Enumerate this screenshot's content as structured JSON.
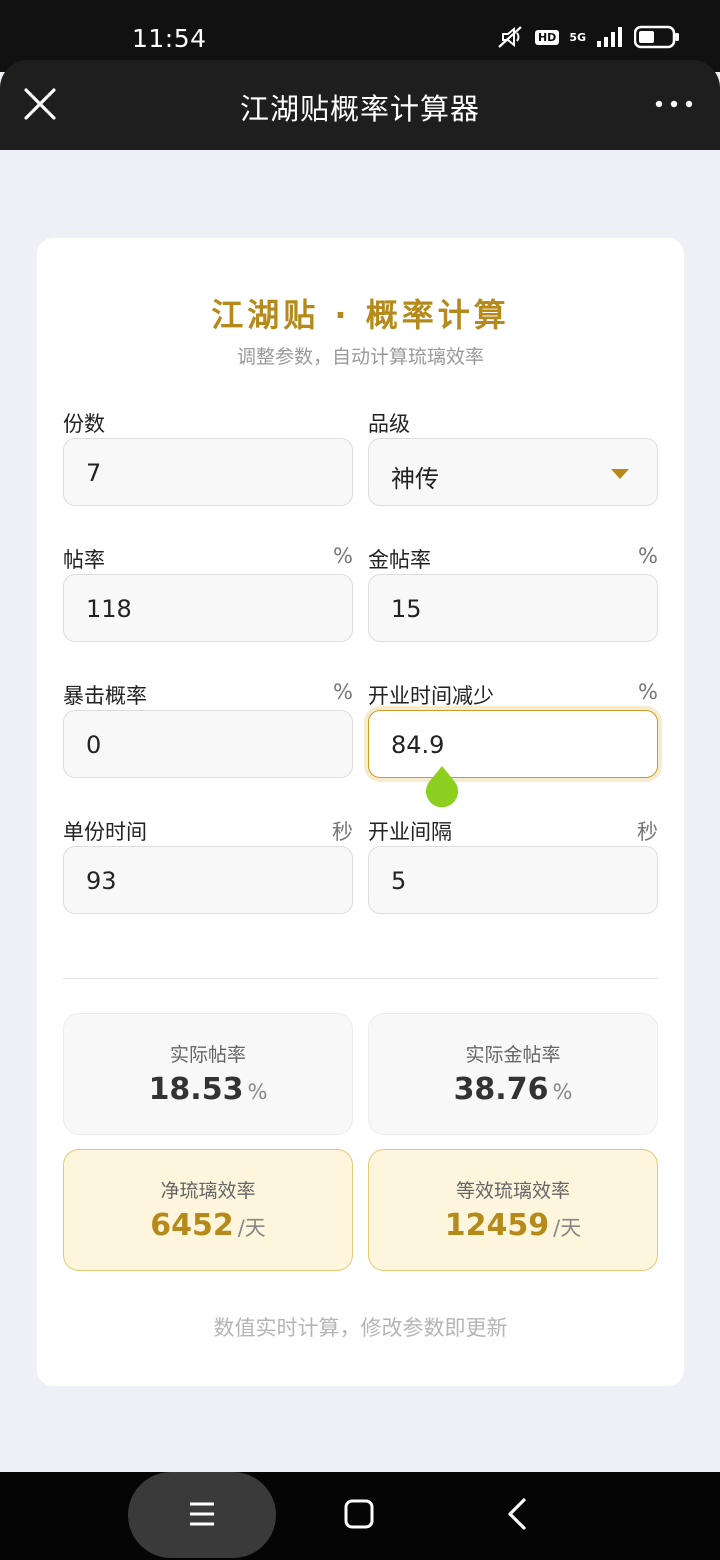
{
  "status_bar": {
    "time": "11:54",
    "hd": "HD",
    "network": "5G",
    "icons": [
      "mute-icon",
      "hd-badge",
      "signal-icon",
      "battery-icon"
    ]
  },
  "nav": {
    "title": "江湖贴概率计算器",
    "close_icon": "close-icon",
    "more_icon": "more-icon"
  },
  "card": {
    "title": "江湖贴 · 概率计算",
    "subtitle": "调整参数，自动计算琉璃效率",
    "fields": {
      "copies": {
        "label": "份数",
        "value": "7"
      },
      "grade": {
        "label": "品级",
        "value": "神传"
      },
      "tie_rate": {
        "label": "帖率",
        "unit": "%",
        "value": "118"
      },
      "gold_tie_rate": {
        "label": "金帖率",
        "unit": "%",
        "value": "15"
      },
      "crit_rate": {
        "label": "暴击概率",
        "unit": "%",
        "value": "0"
      },
      "open_time_reduction": {
        "label": "开业时间减少",
        "unit": "%",
        "value": "84.9"
      },
      "unit_time": {
        "label": "单份时间",
        "unit": "秒",
        "value": "93"
      },
      "open_interval": {
        "label": "开业间隔",
        "unit": "秒",
        "value": "5"
      }
    },
    "results": {
      "actual_tie_rate": {
        "label": "实际帖率",
        "value": "18.53",
        "unit": "%"
      },
      "actual_gold_tie_rate": {
        "label": "实际金帖率",
        "value": "38.76",
        "unit": "%"
      },
      "net_efficiency": {
        "label": "净琉璃效率",
        "value": "6452",
        "unit": "/天"
      },
      "equiv_efficiency": {
        "label": "等效琉璃效率",
        "value": "12459",
        "unit": "/天"
      }
    },
    "footer_note": "数值实时计算，修改参数即更新"
  },
  "colors": {
    "accent": "#b68a1a",
    "result_highlight_bg": "#fdf6dd",
    "focus_border": "#c99a24",
    "handle": "#8ccf1f"
  }
}
